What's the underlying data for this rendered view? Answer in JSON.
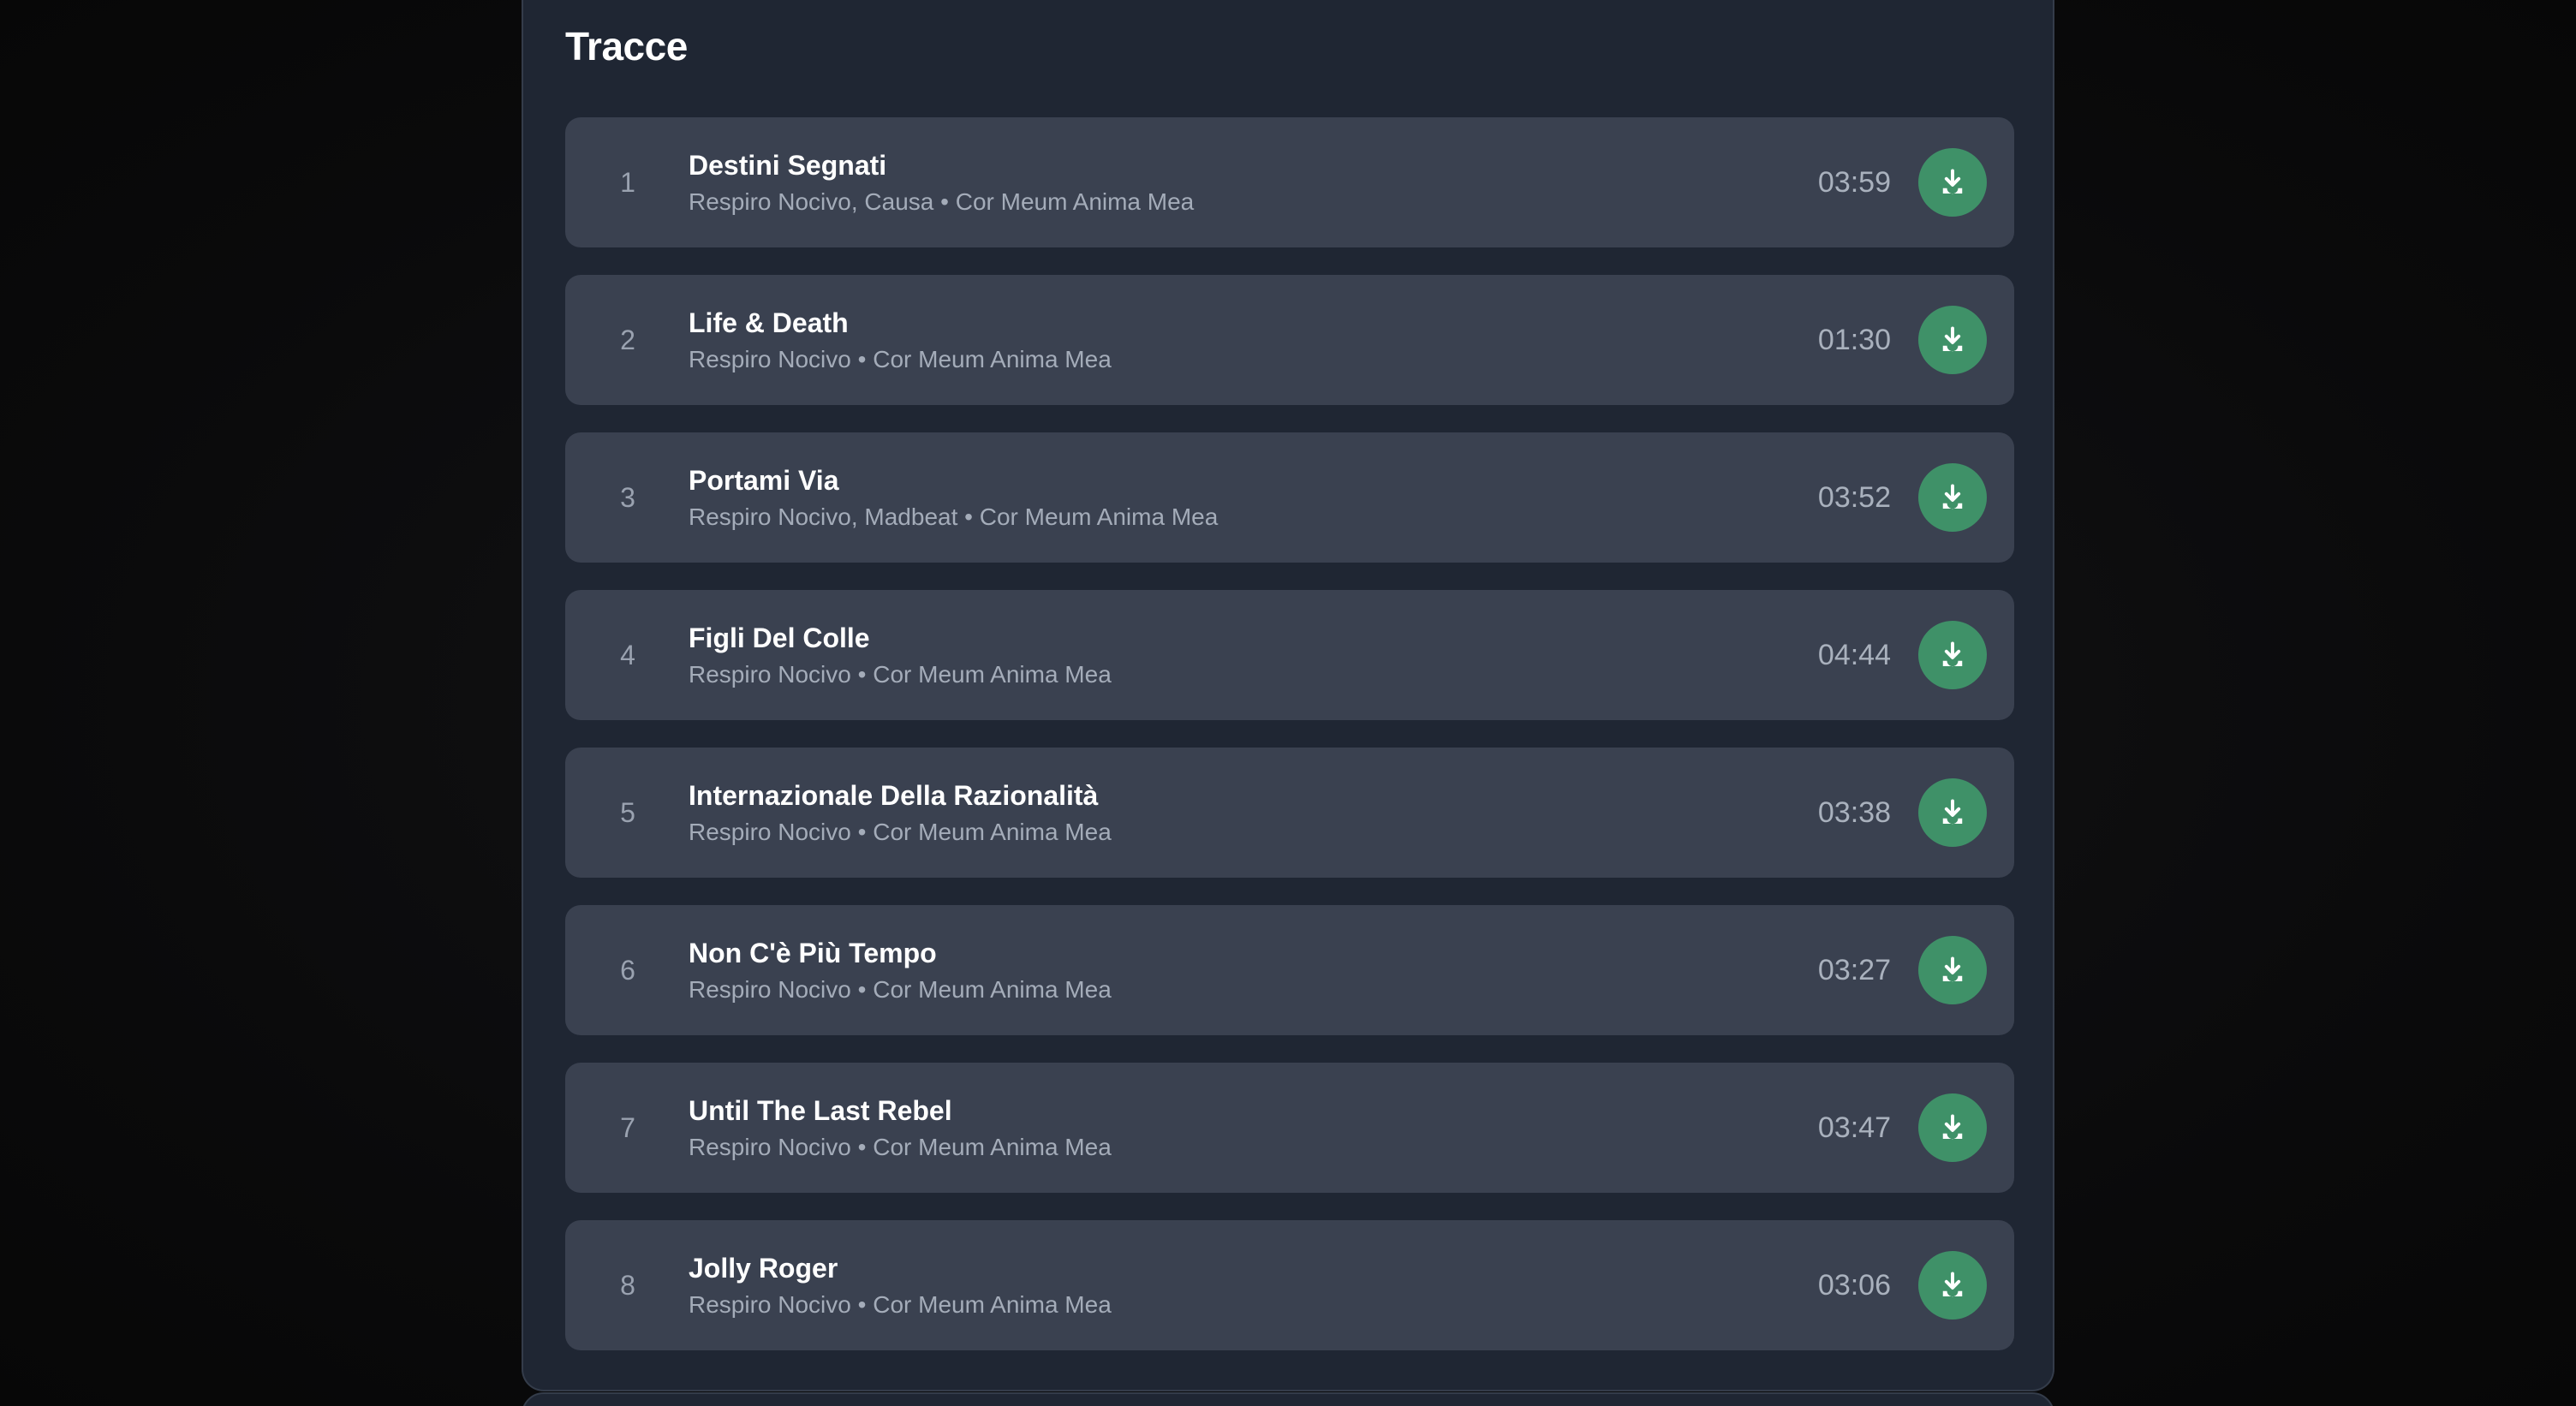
{
  "section": {
    "title": "Tracce"
  },
  "tracks": [
    {
      "number": "1",
      "title": "Destini Segnati",
      "artists": "Respiro Nocivo, Causa",
      "album": "Cor Meum Anima Mea",
      "duration": "03:59"
    },
    {
      "number": "2",
      "title": "Life & Death",
      "artists": "Respiro Nocivo",
      "album": "Cor Meum Anima Mea",
      "duration": "01:30"
    },
    {
      "number": "3",
      "title": "Portami Via",
      "artists": "Respiro Nocivo, Madbeat",
      "album": "Cor Meum Anima Mea",
      "duration": "03:52"
    },
    {
      "number": "4",
      "title": "Figli Del Colle",
      "artists": "Respiro Nocivo",
      "album": "Cor Meum Anima Mea",
      "duration": "04:44"
    },
    {
      "number": "5",
      "title": "Internazionale Della Razionalità",
      "artists": "Respiro Nocivo",
      "album": "Cor Meum Anima Mea",
      "duration": "03:38"
    },
    {
      "number": "6",
      "title": "Non C'è Più Tempo",
      "artists": "Respiro Nocivo",
      "album": "Cor Meum Anima Mea",
      "duration": "03:27"
    },
    {
      "number": "7",
      "title": "Until The Last Rebel",
      "artists": "Respiro Nocivo",
      "album": "Cor Meum Anima Mea",
      "duration": "03:47"
    },
    {
      "number": "8",
      "title": "Jolly Roger",
      "artists": "Respiro Nocivo",
      "album": "Cor Meum Anima Mea",
      "duration": "03:06"
    }
  ],
  "meta_separator": " • ",
  "icons": {
    "download": "download-icon"
  },
  "colors": {
    "accent": "#3f9168",
    "panel": "#1f2633",
    "row": "#3a4150"
  }
}
